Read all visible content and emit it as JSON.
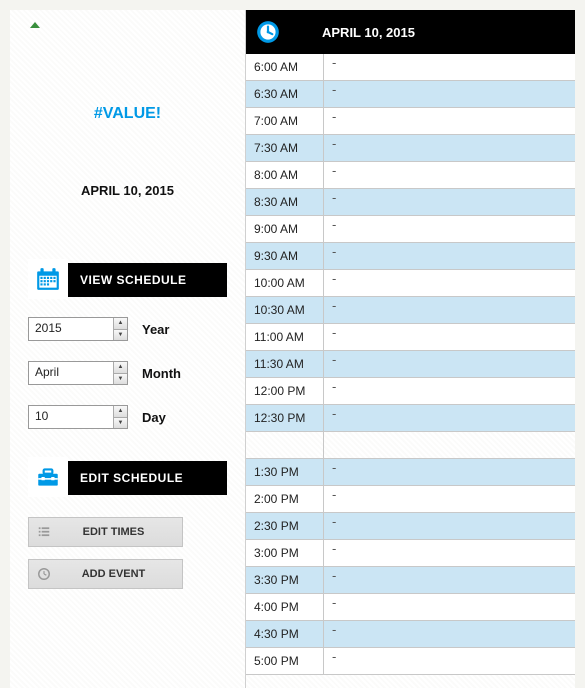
{
  "left": {
    "value_error": "#VALUE!",
    "date_display": "APRIL 10, 2015",
    "view_schedule_label": "VIEW SCHEDULE",
    "edit_schedule_label": "EDIT SCHEDULE",
    "year": {
      "value": "2015",
      "label": "Year"
    },
    "month": {
      "value": "April",
      "label": "Month"
    },
    "day": {
      "value": "10",
      "label": "Day"
    },
    "edit_times_label": "EDIT TIMES",
    "add_event_label": "ADD EVENT"
  },
  "right": {
    "header_date": "APRIL 10, 2015",
    "rows": [
      {
        "time": "6:00 AM",
        "event": "-",
        "even": false
      },
      {
        "time": "6:30 AM",
        "event": "-",
        "even": true
      },
      {
        "time": "7:00 AM",
        "event": "-",
        "even": false
      },
      {
        "time": "7:30 AM",
        "event": "-",
        "even": true
      },
      {
        "time": "8:00 AM",
        "event": "-",
        "even": false
      },
      {
        "time": "8:30 AM",
        "event": "-",
        "even": true
      },
      {
        "time": "9:00 AM",
        "event": "-",
        "even": false
      },
      {
        "time": "9:30 AM",
        "event": "-",
        "even": true
      },
      {
        "time": "10:00 AM",
        "event": "-",
        "even": false
      },
      {
        "time": "10:30 AM",
        "event": "-",
        "even": true
      },
      {
        "time": "11:00 AM",
        "event": "-",
        "even": false
      },
      {
        "time": "11:30 AM",
        "event": "-",
        "even": true
      },
      {
        "time": "12:00 PM",
        "event": "-",
        "even": false
      },
      {
        "time": "12:30 PM",
        "event": "-",
        "even": true
      },
      {
        "time": "",
        "event": "",
        "even": false,
        "gap": true
      },
      {
        "time": "1:30 PM",
        "event": "-",
        "even": true
      },
      {
        "time": "2:00 PM",
        "event": "-",
        "even": false
      },
      {
        "time": "2:30 PM",
        "event": "-",
        "even": true
      },
      {
        "time": "3:00 PM",
        "event": "-",
        "even": false
      },
      {
        "time": "3:30 PM",
        "event": "-",
        "even": true
      },
      {
        "time": "4:00 PM",
        "event": "-",
        "even": false
      },
      {
        "time": "4:30 PM",
        "event": "-",
        "even": true
      },
      {
        "time": "5:00 PM",
        "event": "-",
        "even": false
      }
    ]
  }
}
